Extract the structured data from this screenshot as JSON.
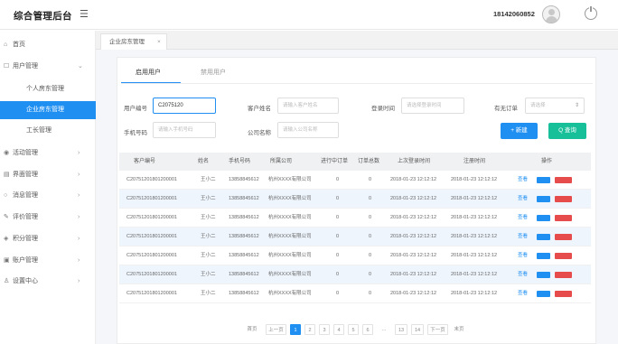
{
  "header": {
    "brand": "综合管理后台",
    "menu_icon": "☰",
    "phone": "18142060852"
  },
  "sidebar": {
    "items": [
      {
        "icon": "⌂",
        "label": "首页",
        "arrow": ""
      },
      {
        "icon": "☐",
        "label": "用户管理",
        "arrow": "⌄"
      },
      {
        "icon": "◉",
        "label": "活动管理",
        "arrow": "›"
      },
      {
        "icon": "▤",
        "label": "界面管理",
        "arrow": "›"
      },
      {
        "icon": "○",
        "label": "消息管理",
        "arrow": "›"
      },
      {
        "icon": "✎",
        "label": "评价管理",
        "arrow": "›"
      },
      {
        "icon": "◈",
        "label": "积分管理",
        "arrow": "›"
      },
      {
        "icon": "▣",
        "label": "账户管理",
        "arrow": "›"
      },
      {
        "icon": "♙",
        "label": "设置中心",
        "arrow": "›"
      }
    ],
    "subitems": [
      {
        "label": "个人房东管理"
      },
      {
        "label": "企业房东管理"
      },
      {
        "label": "工长管理"
      }
    ]
  },
  "tabs": {
    "active": "企业房东管理",
    "close": "×"
  },
  "subtabs": {
    "enabled": "启用用户",
    "disabled": "禁用用户"
  },
  "filters": {
    "user_id_label": "用户编号",
    "user_id_value": "C2075120",
    "name_label": "客户姓名",
    "name_placeholder": "请输入客户姓名",
    "login_label": "登录时间",
    "login_placeholder": "请选择登录时间",
    "order_label": "有无订单",
    "order_placeholder": "请选择",
    "mobile_label": "手机号码",
    "mobile_placeholder": "请输入手机号码",
    "company_label": "公司名称",
    "company_placeholder": "请输入公司名称",
    "add_label": "+ 新建",
    "search_label": "Q 查询"
  },
  "table": {
    "headers": [
      "客户编号",
      "姓名",
      "手机号码",
      "所属公司",
      "进行中订单",
      "订单总数",
      "上次登录时间",
      "注册时间",
      "操作"
    ],
    "rows": [
      [
        "C20751201801200001",
        "王小二",
        "13858845612",
        "杭州XXXX有限公司",
        "0",
        "0",
        "2018-01-23 12:12:12",
        "2018-01-23 12:12:12",
        "查看"
      ],
      [
        "C20751201801200001",
        "王小二",
        "13858845612",
        "杭州XXXX有限公司",
        "0",
        "0",
        "2018-01-23 12:12:12",
        "2018-01-23 12:12:12",
        "查看"
      ],
      [
        "C20751201801200001",
        "王小二",
        "13858845612",
        "杭州XXXX有限公司",
        "0",
        "0",
        "2018-01-23 12:12:12",
        "2018-01-23 12:12:12",
        "查看"
      ],
      [
        "C20751201801200001",
        "王小二",
        "13858845612",
        "杭州XXXX有限公司",
        "0",
        "0",
        "2018-01-23 12:12:12",
        "2018-01-23 12:12:12",
        "查看"
      ],
      [
        "C20751201801200001",
        "王小二",
        "13858845612",
        "杭州XXXX有限公司",
        "0",
        "0",
        "2018-01-23 12:12:12",
        "2018-01-23 12:12:12",
        "查看"
      ],
      [
        "C20751201801200001",
        "王小二",
        "13858845612",
        "杭州XXXX有限公司",
        "0",
        "0",
        "2018-01-23 12:12:12",
        "2018-01-23 12:12:12",
        "查看"
      ],
      [
        "C20751201801200001",
        "王小二",
        "13858845612",
        "杭州XXXX有限公司",
        "0",
        "0",
        "2018-01-23 12:12:12",
        "2018-01-23 12:12:12",
        "查看"
      ]
    ]
  },
  "pager": {
    "first": "首页",
    "prev": "上一页",
    "pages": [
      "1",
      "2",
      "3",
      "4",
      "5",
      "6",
      "...",
      "13",
      "14"
    ],
    "next": "下一页",
    "last": "末页"
  },
  "colors": {
    "accent": "#1f8ff2",
    "success": "#18c09a",
    "danger": "#e74c4c"
  }
}
